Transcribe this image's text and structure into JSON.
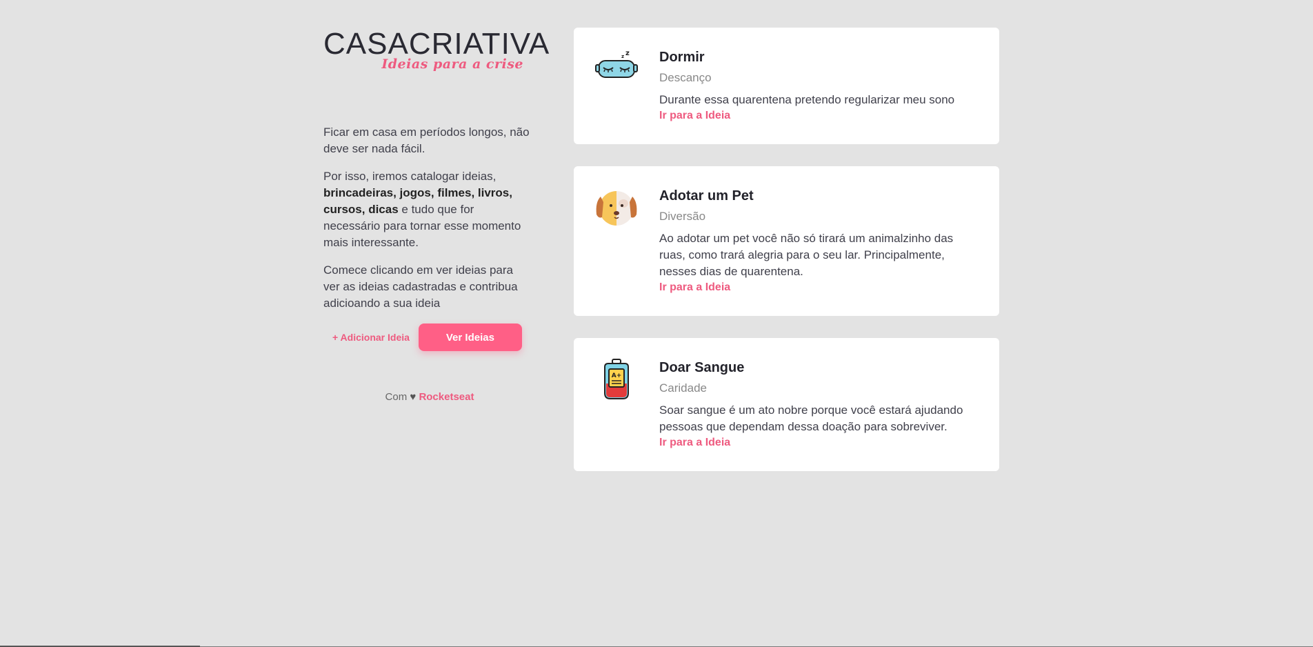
{
  "brand": {
    "logo_bold": "CASA",
    "logo_thin": "CRIATIVA",
    "tagline": "Ideias para a crise"
  },
  "intro": {
    "p1": "Ficar em casa em períodos longos, não deve ser nada fácil.",
    "p2_start": "Por isso, iremos catalogar ideias,",
    "p2_bold": "brincadeiras, jogos, filmes, livros, cursos, dicas",
    "p2_end": "e tudo que for necessário para tornar esse momento mais interessante.",
    "p3": "Comece clicando em ver ideias para ver as ideias cadastradas e contribua adicioando a sua ideia"
  },
  "actions": {
    "add_label": "+ Adicionar Ideia",
    "view_label": "Ver Ideias"
  },
  "footer": {
    "prefix": "Com",
    "heart": "♥",
    "brand": "Rocketseat"
  },
  "ideas": [
    {
      "title": "Dormir",
      "category": "Descanço",
      "description": "Durante essa quarentena pretendo regularizar meu sono",
      "link": "Ir para a Ideia",
      "icon": "sleep-mask-icon"
    },
    {
      "title": "Adotar um Pet",
      "category": "Diversão",
      "description": "Ao adotar um pet você não só tirará um animalzinho das ruas, como trará alegria para o seu lar. Principalmente, nesses dias de quarentena.",
      "link": "Ir para a Ideia",
      "icon": "dog-icon"
    },
    {
      "title": "Doar Sangue",
      "category": "Caridade",
      "description": "Soar sangue é um ato nobre porque você estará ajudando pessoas que dependam dessa doação para sobreviver.",
      "link": "Ir para a Ideia",
      "icon": "blood-bag-icon",
      "icon_text": "A+"
    }
  ],
  "colors": {
    "accent": "#ff5f86",
    "link": "#ee5a7f",
    "background": "#e3e3e3"
  }
}
